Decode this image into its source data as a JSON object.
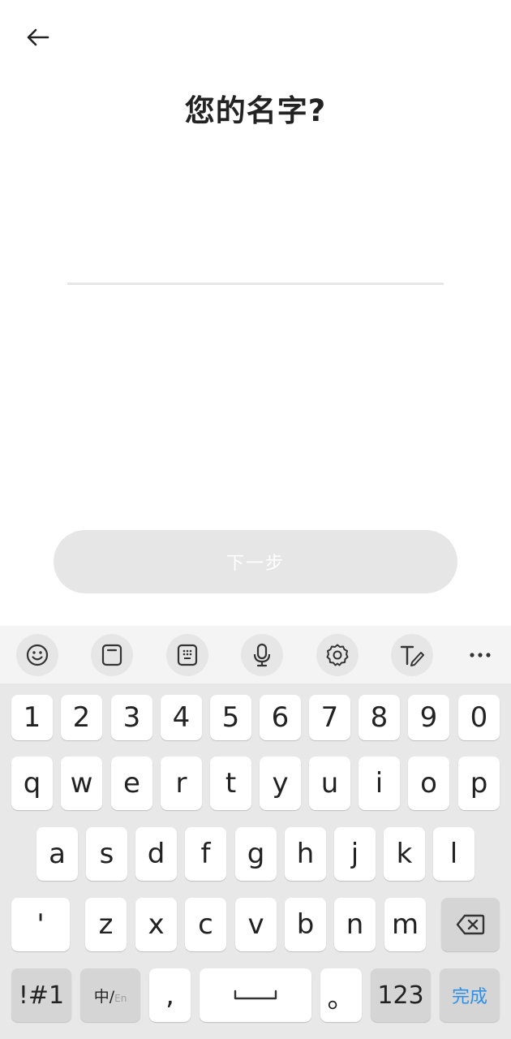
{
  "header": {
    "title": "您的名字?"
  },
  "form": {
    "name_value": "",
    "next_label": "下一步"
  },
  "keyboard": {
    "toolbar": [
      "emoji-icon",
      "clipboard-icon",
      "keypad-icon",
      "microphone-icon",
      "settings-icon",
      "handwriting-icon",
      "more-icon"
    ],
    "number_row": [
      "1",
      "2",
      "3",
      "4",
      "5",
      "6",
      "7",
      "8",
      "9",
      "0"
    ],
    "row1": [
      "q",
      "w",
      "e",
      "r",
      "t",
      "y",
      "u",
      "i",
      "o",
      "p"
    ],
    "row2": [
      "a",
      "s",
      "d",
      "f",
      "g",
      "h",
      "j",
      "k",
      "l"
    ],
    "row3": [
      "'",
      "z",
      "x",
      "c",
      "v",
      "b",
      "n",
      "m"
    ],
    "bottom": {
      "symbols": "!#1",
      "lang_main": "中/",
      "lang_alt": "En",
      "comma": ",",
      "period": "。",
      "num": "123",
      "done": "完成"
    }
  }
}
